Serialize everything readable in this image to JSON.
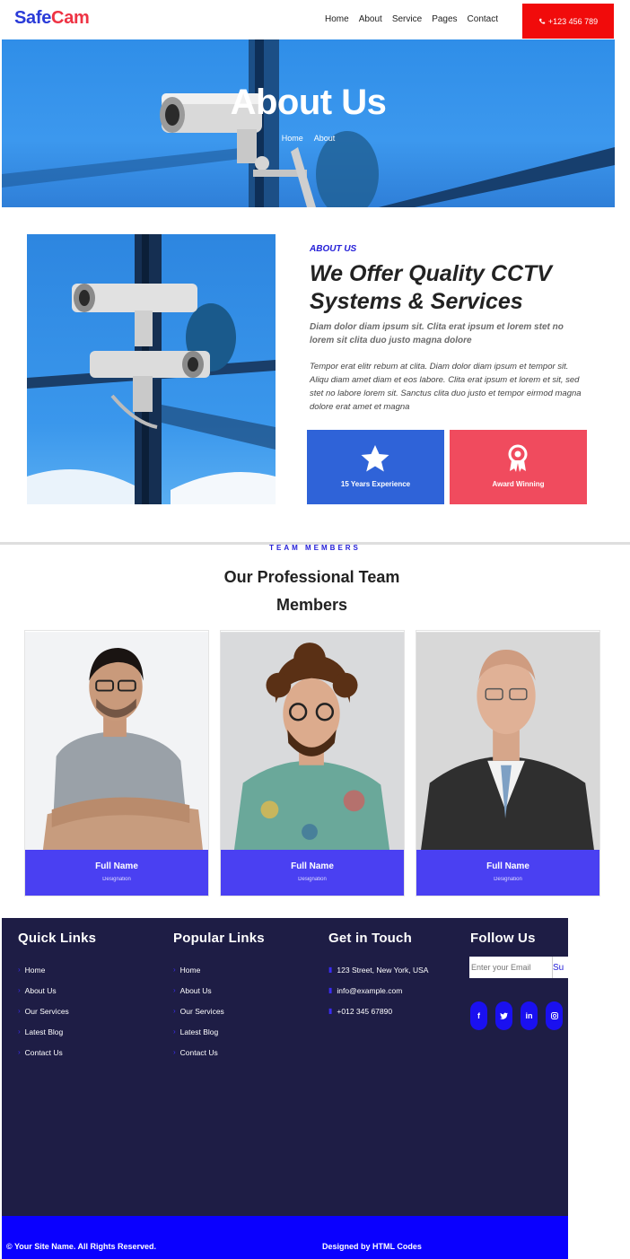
{
  "brand": {
    "part1": "Safe",
    "part2": "Cam"
  },
  "nav": {
    "links": [
      "Home",
      "About",
      "Service",
      "Pages",
      "Contact"
    ],
    "phone": "+123 456 789"
  },
  "hero": {
    "title": "About Us",
    "breadcrumbs": [
      "Home",
      "About"
    ]
  },
  "about": {
    "kicker": "ABOUT US",
    "title": "We Offer Quality CCTV Systems & Services",
    "lead": "Diam dolor diam ipsum sit. Clita erat ipsum et lorem stet no lorem sit clita duo justo magna dolore",
    "body": "Tempor erat elitr rebum at clita. Diam dolor diam ipsum et tempor sit. Aliqu diam amet diam et eos labore. Clita erat ipsum et lorem et sit, sed stet no labore lorem sit. Sanctus clita duo justo et tempor eirmod magna dolore erat amet et magna",
    "stats": [
      {
        "label": "15 Years Experience",
        "icon": "star-icon",
        "color": "#2f63d8"
      },
      {
        "label": "Award Winning",
        "icon": "award-icon",
        "color": "#f04b5e"
      }
    ]
  },
  "team": {
    "kicker": "TEAM MEMBERS",
    "title": "Our Professional Team Members",
    "members": [
      {
        "name": "Full Name",
        "designation": "Designation"
      },
      {
        "name": "Full Name",
        "designation": "Designation"
      },
      {
        "name": "Full Name",
        "designation": "Designation"
      }
    ]
  },
  "footer": {
    "quick_links": {
      "heading": "Quick Links",
      "items": [
        "Home",
        "About Us",
        "Our Services",
        "Latest Blog",
        "Contact Us"
      ]
    },
    "popular_links": {
      "heading": "Popular Links",
      "items": [
        "Home",
        "About Us",
        "Our Services",
        "Latest Blog",
        "Contact Us"
      ]
    },
    "contact": {
      "heading": "Get in Touch",
      "items": [
        "123 Street, New York, USA",
        "info@example.com",
        "+012 345 67890"
      ]
    },
    "follow": {
      "heading": "Follow Us",
      "newsletter_placeholder": "Enter your Email",
      "newsletter_button": "Su",
      "socials": [
        "f",
        "t",
        "in",
        "ig"
      ]
    },
    "copyright": "© Your Site Name. All Rights Reserved.",
    "designed_by": "Designed by HTML Codes"
  },
  "colors": {
    "brand_blue": "#2a3bd8",
    "brand_red": "#ee3344",
    "accent_purple": "#4a40f2",
    "footer_bg": "#1e1d45",
    "footer_bar": "#0a00ff",
    "phone_bg": "#f10b0b"
  }
}
